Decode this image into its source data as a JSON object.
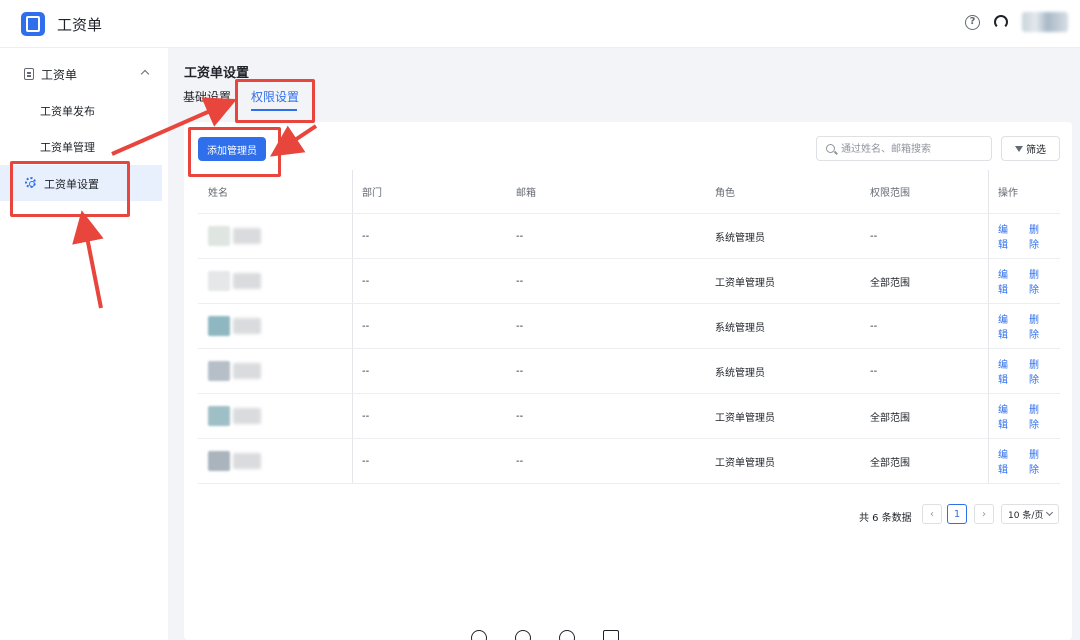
{
  "app": {
    "title": "工资单"
  },
  "sidebar": {
    "group_label": "工资单",
    "items": [
      {
        "label": "工资单发布"
      },
      {
        "label": "工资单管理"
      },
      {
        "label": "工资单设置"
      }
    ]
  },
  "page": {
    "title": "工资单设置",
    "tabs": [
      {
        "label": "基础设置"
      },
      {
        "label": "权限设置"
      }
    ]
  },
  "toolbar": {
    "add_label": "添加管理员",
    "search_placeholder": "通过姓名、邮箱搜索",
    "filter_label": "筛选"
  },
  "table": {
    "columns": [
      "姓名",
      "部门",
      "邮箱",
      "角色",
      "权限范围",
      "操作"
    ],
    "rows": [
      {
        "dept": "--",
        "email": "--",
        "role": "系统管理员",
        "scope": "--"
      },
      {
        "dept": "--",
        "email": "--",
        "role": "工资单管理员",
        "scope": "全部范围"
      },
      {
        "dept": "--",
        "email": "--",
        "role": "系统管理员",
        "scope": "--"
      },
      {
        "dept": "--",
        "email": "--",
        "role": "系统管理员",
        "scope": "--"
      },
      {
        "dept": "--",
        "email": "--",
        "role": "工资单管理员",
        "scope": "全部范围"
      },
      {
        "dept": "--",
        "email": "--",
        "role": "工资单管理员",
        "scope": "全部范围"
      }
    ],
    "edit_label": "编辑",
    "delete_label": "删除"
  },
  "pagination": {
    "total_text": "共 6 条数据",
    "current_page": "1",
    "page_size": "10 条/页",
    "prev": "‹",
    "next": "›"
  },
  "colors": {
    "accent": "#2f6fec",
    "annotation": "#e8453c"
  }
}
